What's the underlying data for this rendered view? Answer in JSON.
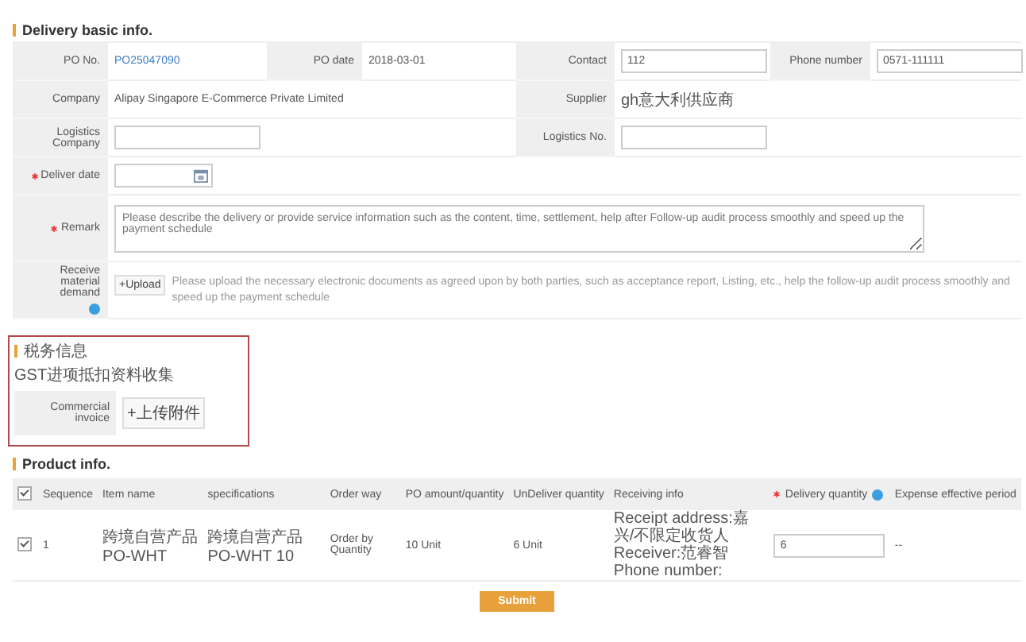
{
  "basic_info": {
    "title": "Delivery basic info.",
    "rows": [
      {
        "fields": [
          {
            "label": "PO No.",
            "kind": "link",
            "value": "PO25047090"
          },
          {
            "label": "PO date",
            "kind": "text",
            "value": "2018-03-01"
          },
          {
            "label": "Contact",
            "kind": "input",
            "value": "112"
          },
          {
            "label": "Phone number",
            "kind": "input",
            "value": "0571-111111"
          }
        ]
      },
      {
        "fields": [
          {
            "label": "Company",
            "kind": "text",
            "value": "Alipay Singapore E-Commerce Private Limited"
          },
          {
            "label": "Supplier",
            "kind": "text",
            "value": "gh意大利供应商"
          }
        ]
      },
      {
        "fields": [
          {
            "label": "Logistics Company",
            "kind": "input"
          },
          {
            "label": "Logistics No.",
            "kind": "input"
          }
        ]
      },
      {
        "fields": [
          {
            "label": "Deliver date",
            "kind": "date",
            "required": true
          }
        ]
      },
      {
        "fields": [
          {
            "label": "Remark",
            "kind": "textarea",
            "required": true,
            "placeholder": "Please describe the delivery or provide service information such as the content, time, settlement, help after Follow-up audit process smoothly and speed up the payment schedule"
          }
        ]
      },
      {
        "fields": [
          {
            "label": "Receive material demand",
            "kind": "upload",
            "info": true,
            "button": "+Upload",
            "hint": "Please upload the necessary electronic documents as agreed upon by both parties, such as acceptance report, Listing, etc., help the follow-up audit process smoothly and speed up the payment schedule"
          }
        ]
      }
    ]
  },
  "tax_info": {
    "title": "税务信息",
    "note": "GST进项抵扣资料收集",
    "label": "Commercial invoice",
    "button": "+上传附件"
  },
  "product_info": {
    "title": "Product info.",
    "all_checked": true,
    "columns": [
      {
        "label": "Sequence"
      },
      {
        "label": "Item name"
      },
      {
        "label": "specifications"
      },
      {
        "label": "Order way"
      },
      {
        "label": "PO amount/quantity"
      },
      {
        "label": "UnDeliver quantity"
      },
      {
        "label": "Receiving info"
      },
      {
        "label": "Delivery quantity",
        "required": true,
        "info": true
      },
      {
        "label": "Expense effective period"
      }
    ],
    "rows": [
      {
        "checked": true,
        "sequence": "1",
        "item_name": "跨境自营产品PO-WHT",
        "specifications": "跨境自营产品PO-WHT 10",
        "order_way": "Order by Quantity",
        "po_amount": "10 Unit",
        "undeliver": "6 Unit",
        "receiving_info": [
          "Receipt address:嘉兴/不限定收货人",
          "Receiver:范睿智",
          "Phone number:"
        ],
        "delivery_quantity": "6",
        "expense_period": "--"
      }
    ]
  },
  "submit": "Submit"
}
